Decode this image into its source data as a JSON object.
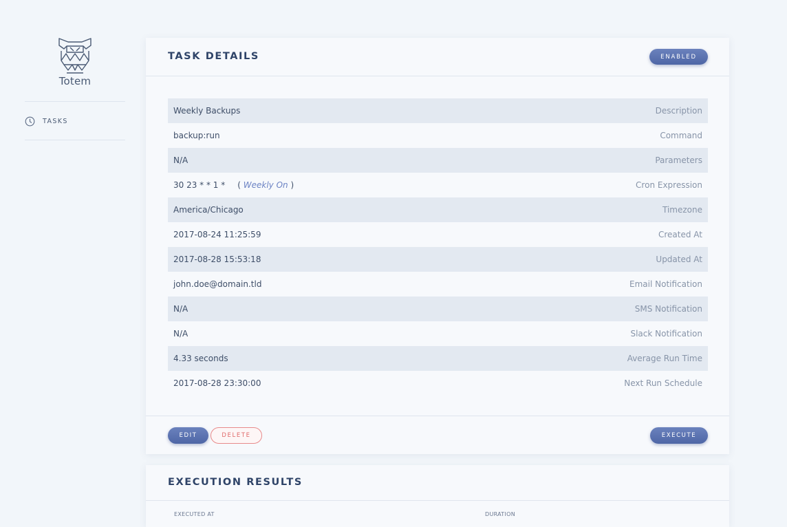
{
  "sidebar": {
    "brand": "Totem",
    "nav": [
      {
        "label": "TASKS",
        "icon": "clock-icon"
      }
    ]
  },
  "task_details": {
    "title": "TASK DETAILS",
    "status_badge": "ENABLED",
    "rows": [
      {
        "value": "Weekly Backups",
        "label": "Description"
      },
      {
        "value": "backup:run",
        "label": "Command"
      },
      {
        "value": "N/A",
        "label": "Parameters"
      },
      {
        "value": "30 23 * * 1 *",
        "label": "Cron Expression",
        "extra_open": "(",
        "extra_link": "Weekly On",
        "extra_close": ")"
      },
      {
        "value": "America/Chicago",
        "label": "Timezone"
      },
      {
        "value": "2017-08-24 11:25:59",
        "label": "Created At"
      },
      {
        "value": "2017-08-28 15:53:18",
        "label": "Updated At"
      },
      {
        "value": "john.doe@domain.tld",
        "label": "Email Notification"
      },
      {
        "value": "N/A",
        "label": "SMS Notification"
      },
      {
        "value": "N/A",
        "label": "Slack Notification"
      },
      {
        "value": "4.33 seconds",
        "label": "Average Run Time"
      },
      {
        "value": "2017-08-28 23:30:00",
        "label": "Next Run Schedule"
      }
    ],
    "actions": {
      "edit": "EDIT",
      "delete": "DELETE",
      "execute": "EXECUTE"
    }
  },
  "execution_results": {
    "title": "EXECUTION RESULTS",
    "columns": [
      "EXECUTED AT",
      "DURATION"
    ]
  },
  "colors": {
    "accent": "#5a71b0",
    "danger": "#e06a6a",
    "background": "#f2f6fa",
    "row_shade": "#e3e9f1"
  }
}
